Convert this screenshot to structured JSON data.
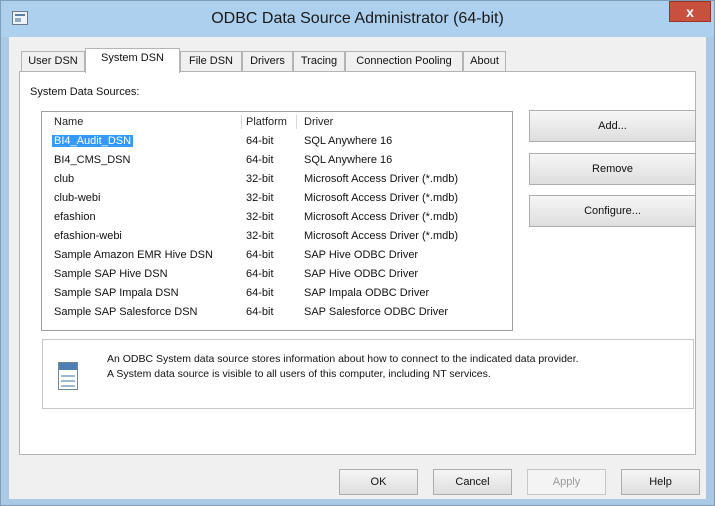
{
  "window": {
    "title": "ODBC Data Source Administrator (64-bit)",
    "close_label": "x"
  },
  "tabs": [
    {
      "label": "User DSN"
    },
    {
      "label": "System DSN",
      "active": true
    },
    {
      "label": "File DSN"
    },
    {
      "label": "Drivers"
    },
    {
      "label": "Tracing"
    },
    {
      "label": "Connection Pooling"
    },
    {
      "label": "About"
    }
  ],
  "system_data_sources": {
    "label": "System Data Sources:",
    "columns": [
      "Name",
      "Platform",
      "Driver"
    ],
    "rows": [
      {
        "name": "BI4_Audit_DSN",
        "platform": "64-bit",
        "driver": "SQL Anywhere 16",
        "selected": true
      },
      {
        "name": "BI4_CMS_DSN",
        "platform": "64-bit",
        "driver": "SQL Anywhere 16"
      },
      {
        "name": "club",
        "platform": "32-bit",
        "driver": "Microsoft Access Driver (*.mdb)"
      },
      {
        "name": "club-webi",
        "platform": "32-bit",
        "driver": "Microsoft Access Driver (*.mdb)"
      },
      {
        "name": "efashion",
        "platform": "32-bit",
        "driver": "Microsoft Access Driver (*.mdb)"
      },
      {
        "name": "efashion-webi",
        "platform": "32-bit",
        "driver": "Microsoft Access Driver (*.mdb)"
      },
      {
        "name": "Sample Amazon EMR Hive DSN",
        "platform": "64-bit",
        "driver": "SAP Hive ODBC Driver"
      },
      {
        "name": "Sample SAP Hive DSN",
        "platform": "64-bit",
        "driver": "SAP Hive ODBC Driver"
      },
      {
        "name": "Sample SAP Impala DSN",
        "platform": "64-bit",
        "driver": "SAP Impala ODBC Driver"
      },
      {
        "name": "Sample SAP Salesforce DSN",
        "platform": "64-bit",
        "driver": "SAP Salesforce ODBC Driver"
      }
    ]
  },
  "side_buttons": {
    "add": "Add...",
    "remove": "Remove",
    "configure": "Configure..."
  },
  "info": {
    "line1": "An ODBC System data source stores information about how to connect to the indicated data provider.",
    "line2": "A System data source is visible to all users of this computer, including NT services."
  },
  "bottom_buttons": {
    "ok": "OK",
    "cancel": "Cancel",
    "apply": "Apply",
    "help": "Help"
  }
}
